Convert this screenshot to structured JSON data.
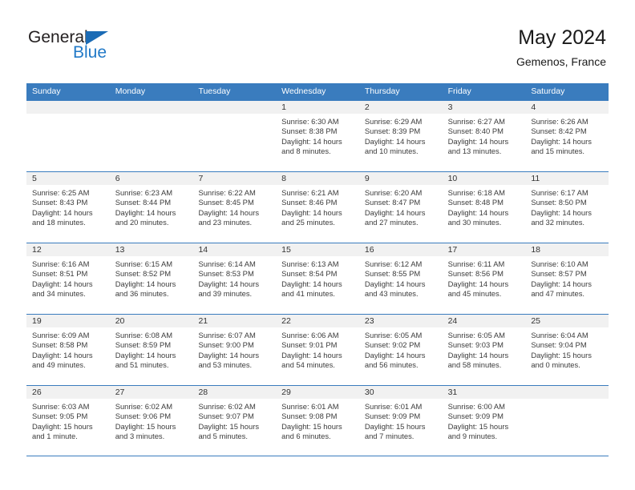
{
  "brand": {
    "name_top": "General",
    "name_bottom": "Blue",
    "accent_color": "#2179c7",
    "triangle_color": "#1b6bb5"
  },
  "header": {
    "title": "May 2024",
    "subtitle": "Gemenos, France"
  },
  "theme": {
    "header_row_color": "#3a7cbe",
    "daynum_band_color": "#f1f1f1",
    "text_color": "#3b3b3b"
  },
  "weekdays": [
    "Sunday",
    "Monday",
    "Tuesday",
    "Wednesday",
    "Thursday",
    "Friday",
    "Saturday"
  ],
  "labels": {
    "sunrise": "Sunrise:",
    "sunset": "Sunset:",
    "daylight": "Daylight:"
  },
  "weeks": [
    [
      {
        "day": "",
        "empty": true
      },
      {
        "day": "",
        "empty": true
      },
      {
        "day": "",
        "empty": true
      },
      {
        "day": "1",
        "sunrise": "Sunrise: 6:30 AM",
        "sunset": "Sunset: 8:38 PM",
        "daylight": "Daylight: 14 hours and 8 minutes."
      },
      {
        "day": "2",
        "sunrise": "Sunrise: 6:29 AM",
        "sunset": "Sunset: 8:39 PM",
        "daylight": "Daylight: 14 hours and 10 minutes."
      },
      {
        "day": "3",
        "sunrise": "Sunrise: 6:27 AM",
        "sunset": "Sunset: 8:40 PM",
        "daylight": "Daylight: 14 hours and 13 minutes."
      },
      {
        "day": "4",
        "sunrise": "Sunrise: 6:26 AM",
        "sunset": "Sunset: 8:42 PM",
        "daylight": "Daylight: 14 hours and 15 minutes."
      }
    ],
    [
      {
        "day": "5",
        "sunrise": "Sunrise: 6:25 AM",
        "sunset": "Sunset: 8:43 PM",
        "daylight": "Daylight: 14 hours and 18 minutes."
      },
      {
        "day": "6",
        "sunrise": "Sunrise: 6:23 AM",
        "sunset": "Sunset: 8:44 PM",
        "daylight": "Daylight: 14 hours and 20 minutes."
      },
      {
        "day": "7",
        "sunrise": "Sunrise: 6:22 AM",
        "sunset": "Sunset: 8:45 PM",
        "daylight": "Daylight: 14 hours and 23 minutes."
      },
      {
        "day": "8",
        "sunrise": "Sunrise: 6:21 AM",
        "sunset": "Sunset: 8:46 PM",
        "daylight": "Daylight: 14 hours and 25 minutes."
      },
      {
        "day": "9",
        "sunrise": "Sunrise: 6:20 AM",
        "sunset": "Sunset: 8:47 PM",
        "daylight": "Daylight: 14 hours and 27 minutes."
      },
      {
        "day": "10",
        "sunrise": "Sunrise: 6:18 AM",
        "sunset": "Sunset: 8:48 PM",
        "daylight": "Daylight: 14 hours and 30 minutes."
      },
      {
        "day": "11",
        "sunrise": "Sunrise: 6:17 AM",
        "sunset": "Sunset: 8:50 PM",
        "daylight": "Daylight: 14 hours and 32 minutes."
      }
    ],
    [
      {
        "day": "12",
        "sunrise": "Sunrise: 6:16 AM",
        "sunset": "Sunset: 8:51 PM",
        "daylight": "Daylight: 14 hours and 34 minutes."
      },
      {
        "day": "13",
        "sunrise": "Sunrise: 6:15 AM",
        "sunset": "Sunset: 8:52 PM",
        "daylight": "Daylight: 14 hours and 36 minutes."
      },
      {
        "day": "14",
        "sunrise": "Sunrise: 6:14 AM",
        "sunset": "Sunset: 8:53 PM",
        "daylight": "Daylight: 14 hours and 39 minutes."
      },
      {
        "day": "15",
        "sunrise": "Sunrise: 6:13 AM",
        "sunset": "Sunset: 8:54 PM",
        "daylight": "Daylight: 14 hours and 41 minutes."
      },
      {
        "day": "16",
        "sunrise": "Sunrise: 6:12 AM",
        "sunset": "Sunset: 8:55 PM",
        "daylight": "Daylight: 14 hours and 43 minutes."
      },
      {
        "day": "17",
        "sunrise": "Sunrise: 6:11 AM",
        "sunset": "Sunset: 8:56 PM",
        "daylight": "Daylight: 14 hours and 45 minutes."
      },
      {
        "day": "18",
        "sunrise": "Sunrise: 6:10 AM",
        "sunset": "Sunset: 8:57 PM",
        "daylight": "Daylight: 14 hours and 47 minutes."
      }
    ],
    [
      {
        "day": "19",
        "sunrise": "Sunrise: 6:09 AM",
        "sunset": "Sunset: 8:58 PM",
        "daylight": "Daylight: 14 hours and 49 minutes."
      },
      {
        "day": "20",
        "sunrise": "Sunrise: 6:08 AM",
        "sunset": "Sunset: 8:59 PM",
        "daylight": "Daylight: 14 hours and 51 minutes."
      },
      {
        "day": "21",
        "sunrise": "Sunrise: 6:07 AM",
        "sunset": "Sunset: 9:00 PM",
        "daylight": "Daylight: 14 hours and 53 minutes."
      },
      {
        "day": "22",
        "sunrise": "Sunrise: 6:06 AM",
        "sunset": "Sunset: 9:01 PM",
        "daylight": "Daylight: 14 hours and 54 minutes."
      },
      {
        "day": "23",
        "sunrise": "Sunrise: 6:05 AM",
        "sunset": "Sunset: 9:02 PM",
        "daylight": "Daylight: 14 hours and 56 minutes."
      },
      {
        "day": "24",
        "sunrise": "Sunrise: 6:05 AM",
        "sunset": "Sunset: 9:03 PM",
        "daylight": "Daylight: 14 hours and 58 minutes."
      },
      {
        "day": "25",
        "sunrise": "Sunrise: 6:04 AM",
        "sunset": "Sunset: 9:04 PM",
        "daylight": "Daylight: 15 hours and 0 minutes."
      }
    ],
    [
      {
        "day": "26",
        "sunrise": "Sunrise: 6:03 AM",
        "sunset": "Sunset: 9:05 PM",
        "daylight": "Daylight: 15 hours and 1 minute."
      },
      {
        "day": "27",
        "sunrise": "Sunrise: 6:02 AM",
        "sunset": "Sunset: 9:06 PM",
        "daylight": "Daylight: 15 hours and 3 minutes."
      },
      {
        "day": "28",
        "sunrise": "Sunrise: 6:02 AM",
        "sunset": "Sunset: 9:07 PM",
        "daylight": "Daylight: 15 hours and 5 minutes."
      },
      {
        "day": "29",
        "sunrise": "Sunrise: 6:01 AM",
        "sunset": "Sunset: 9:08 PM",
        "daylight": "Daylight: 15 hours and 6 minutes."
      },
      {
        "day": "30",
        "sunrise": "Sunrise: 6:01 AM",
        "sunset": "Sunset: 9:09 PM",
        "daylight": "Daylight: 15 hours and 7 minutes."
      },
      {
        "day": "31",
        "sunrise": "Sunrise: 6:00 AM",
        "sunset": "Sunset: 9:09 PM",
        "daylight": "Daylight: 15 hours and 9 minutes."
      },
      {
        "day": "",
        "empty": true
      }
    ]
  ]
}
